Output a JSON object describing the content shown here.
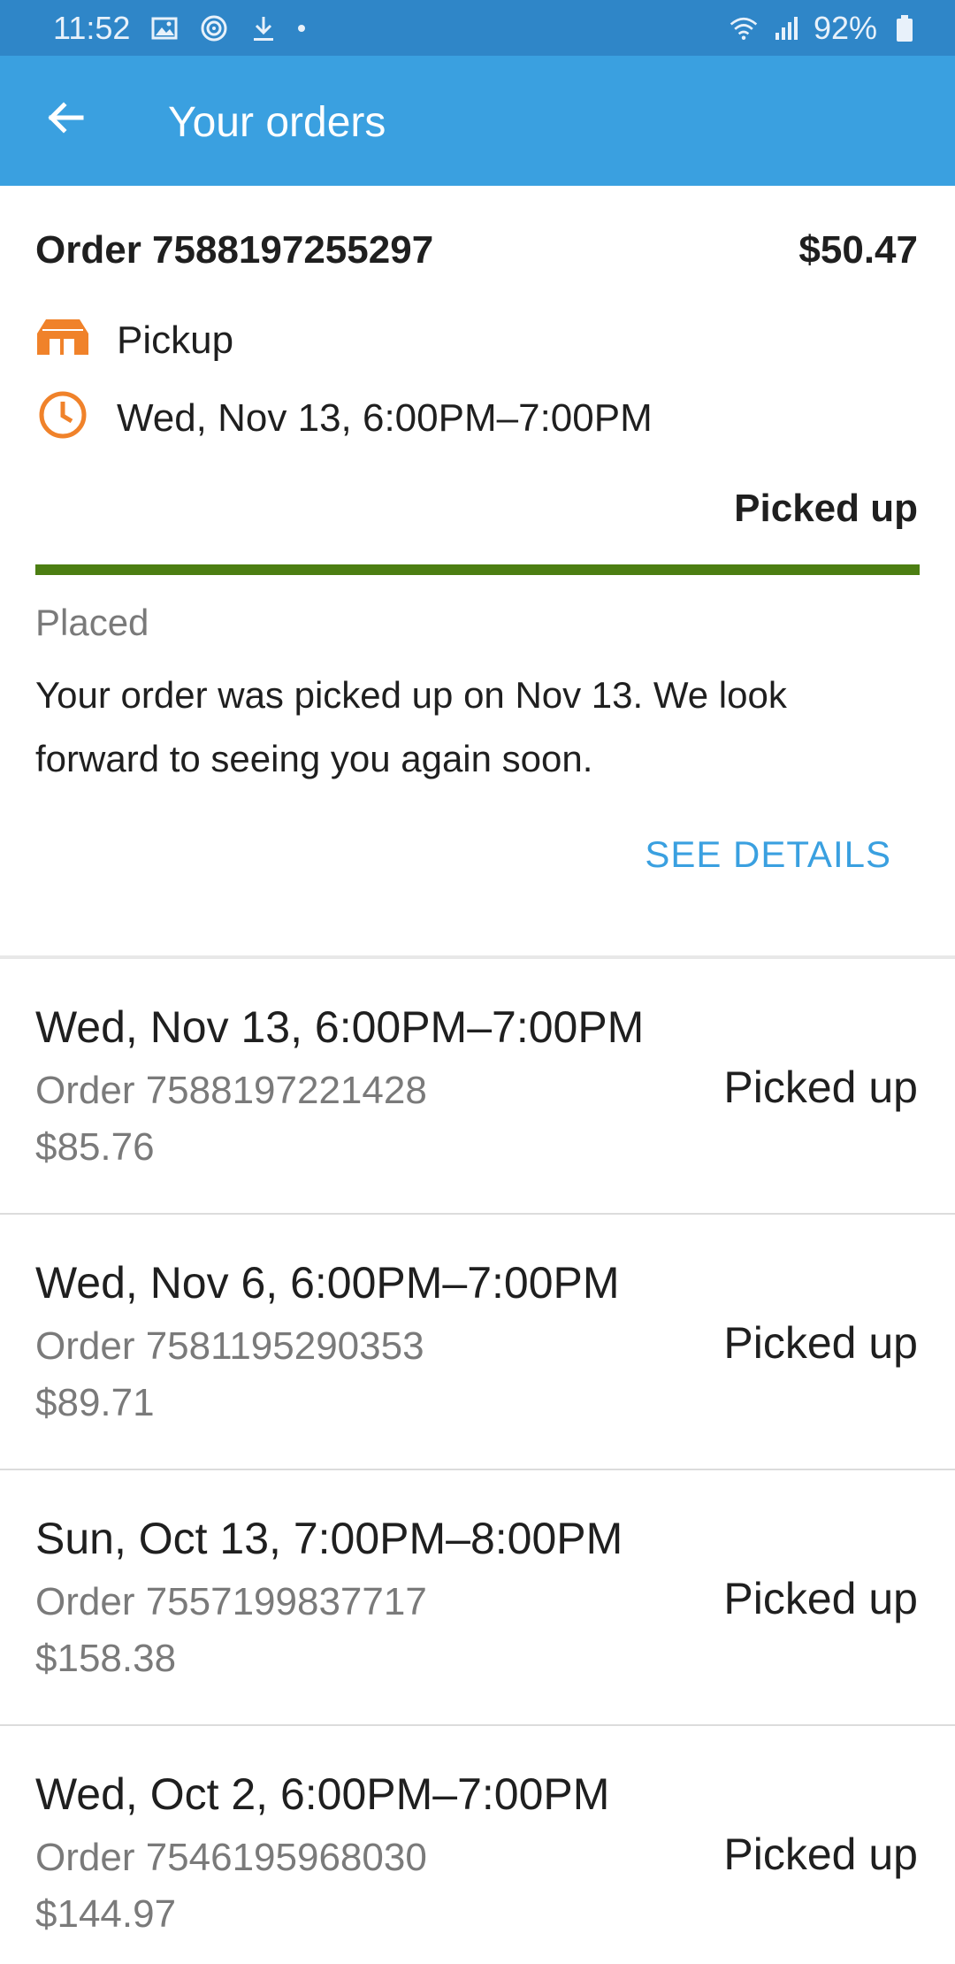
{
  "status_bar": {
    "time": "11:52",
    "battery": "92%",
    "icons": [
      "image-icon",
      "nfc-icon",
      "download-icon",
      "wifi-icon",
      "signal-icon",
      "battery-icon"
    ]
  },
  "app_bar": {
    "title": "Your orders",
    "back_icon": "arrow-left-icon",
    "color": "#3aa0e0"
  },
  "current_order": {
    "order_number": "Order 7588197255297",
    "total": "$50.47",
    "fulfillment": "Pickup",
    "fulfillment_icon": "store-icon",
    "time_window": "Wed, Nov 13, 6:00PM–7:00PM",
    "time_icon": "clock-icon",
    "status": "Picked up",
    "progress": 1.0,
    "progress_color": "#4c7e12",
    "step_label": "Placed",
    "message": "Your order was picked up on Nov 13. We look forward to seeing you again soon.",
    "see_details_label": "SEE DETAILS",
    "icon_color": "#f0822a"
  },
  "orders": [
    {
      "window": "Wed, Nov 13, 6:00PM–7:00PM",
      "order": "Order 7588197221428",
      "total": "$85.76",
      "status": "Picked up"
    },
    {
      "window": "Wed, Nov 6, 6:00PM–7:00PM",
      "order": "Order 7581195290353",
      "total": "$89.71",
      "status": "Picked up"
    },
    {
      "window": "Sun, Oct 13, 7:00PM–8:00PM",
      "order": "Order 7557199837717",
      "total": "$158.38",
      "status": "Picked up"
    },
    {
      "window": "Wed, Oct 2, 6:00PM–7:00PM",
      "order": "Order 7546195968030",
      "total": "$144.97",
      "status": "Picked up"
    }
  ]
}
